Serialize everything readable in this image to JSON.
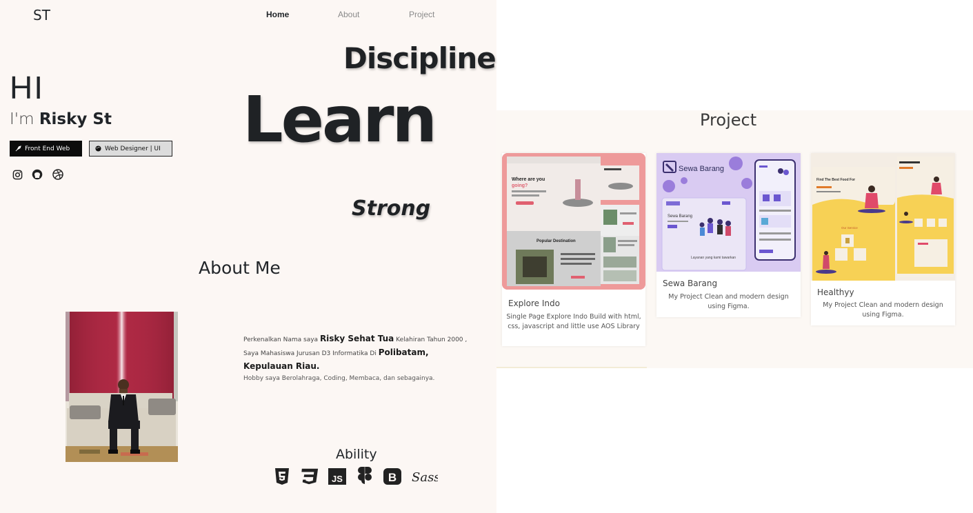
{
  "logo": "ST",
  "nav": {
    "home": "Home",
    "about": "About",
    "project": "Project"
  },
  "hero": {
    "hi": "HI",
    "im": "I'm",
    "name": "Risky St",
    "badge_frontend": "Front End Web",
    "badge_designer": "Web Designer | UI",
    "words": {
      "discipline": "Discipline",
      "learn": "Learn",
      "strong": "Strong"
    }
  },
  "social_icons": [
    "instagram-icon",
    "github-icon",
    "dribbble-icon"
  ],
  "about": {
    "title": "About Me",
    "p1_a": "Perkenalkan Nama saya ",
    "p1_name": "Risky Sehat Tua",
    "p1_b": " Kelahiran Tahun 2000 , Saya Mahasiswa Jurusan D3 Informatika Di ",
    "p1_place": "Polibatam, Kepulauan Riau.",
    "hobby": "Hobby saya Berolahraga, Coding, Membaca, dan sebagainya."
  },
  "ability": {
    "title": "Ability",
    "icons": [
      "html5-icon",
      "css3-icon",
      "js-icon",
      "figma-icon",
      "bootstrap-icon",
      "sass-icon"
    ],
    "js_label": "JS",
    "bootstrap_label": "B",
    "sass_label": "Sass"
  },
  "project": {
    "title": "Project",
    "cards": [
      {
        "title": "Explore Indo",
        "desc": "Single Page Explore Indo Build with html, css, javascript and little use AOS Library",
        "thumb_color": "#ee9a9a",
        "thumb_text": {
          "heading": "Where are you",
          "highlight": "going?",
          "section": "Popular Destination"
        }
      },
      {
        "title": "Sewa Barang",
        "desc": "My Project Clean and modern design using Figma.",
        "thumb_color": "#d9cbf2",
        "thumb_text": {
          "brand": "Sewa Barang",
          "inner": "Sewa Barang",
          "tagline": "Layanan yang kami tawarkan"
        }
      },
      {
        "title": "Healthyy",
        "desc": "My Project Clean and modern design using Figma.",
        "thumb_color": "#f7d155",
        "thumb_text": {
          "headline": "Find The Best Food For",
          "sub": "Our Service"
        }
      }
    ]
  },
  "colors": {
    "left_bg": "#fcf7f4",
    "dark": "#212529",
    "card1": "#ee9a9a",
    "card2": "#d9cbf2",
    "card3": "#f7d155"
  }
}
